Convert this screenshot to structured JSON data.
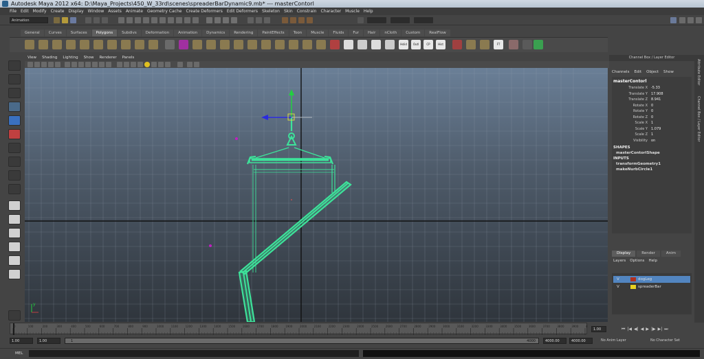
{
  "window": {
    "title": "Autodesk Maya 2012 x64: D:\\Maya_Projects\\450_W_33rd\\scenes\\spreaderBarDynamic9.mb*   ---   masterContorl"
  },
  "menubar": [
    "File",
    "Edit",
    "Modify",
    "Create",
    "Display",
    "Window",
    "Assets",
    "Animate",
    "Geometry Cache",
    "Create Deformers",
    "Edit Deformers",
    "Skeleton",
    "Skin",
    "Constrain",
    "Character",
    "Muscle",
    "Help"
  ],
  "status_line": {
    "mode": "Animation"
  },
  "shelf": {
    "tabs": [
      "General",
      "Curves",
      "Surfaces",
      "Polygons",
      "Subdivs",
      "Deformation",
      "Animation",
      "Dynamics",
      "Rendering",
      "PaintEffects",
      "Toon",
      "Muscle",
      "Fluids",
      "Fur",
      "Hair",
      "nCloth",
      "Custom",
      "RealFlow"
    ],
    "active_tab": "Polygons",
    "icon_labels": [
      "Hslid",
      "Outl",
      "CP",
      "Hist",
      "FT"
    ]
  },
  "panel": {
    "menu": [
      "View",
      "Shading",
      "Lighting",
      "Show",
      "Renderer",
      "Panels"
    ]
  },
  "channel_box": {
    "header": "Channel Box / Layer Editor",
    "menu": [
      "Channels",
      "Edit",
      "Object",
      "Show"
    ],
    "object": "masterContorl",
    "attributes": [
      {
        "label": "Translate X",
        "value": "-5.33"
      },
      {
        "label": "Translate Y",
        "value": "17.908"
      },
      {
        "label": "Translate Z",
        "value": "8.941"
      },
      {
        "label": "Rotate X",
        "value": "0"
      },
      {
        "label": "Rotate Y",
        "value": "0"
      },
      {
        "label": "Rotate Z",
        "value": "0"
      },
      {
        "label": "Scale X",
        "value": "1"
      },
      {
        "label": "Scale Y",
        "value": "1.079"
      },
      {
        "label": "Scale Z",
        "value": "1"
      },
      {
        "label": "Visibility",
        "value": "on"
      }
    ],
    "shapes_header": "SHAPES",
    "shape": "masterContorlShape",
    "inputs_header": "INPUTS",
    "inputs": [
      "transformGeometry1",
      "makeNurbCircle1"
    ]
  },
  "layer_editor": {
    "tabs": [
      "Display",
      "Render",
      "Anim"
    ],
    "active_tab": "Display",
    "menu": [
      "Layers",
      "Options",
      "Help"
    ],
    "layers": [
      {
        "vis": "V",
        "name": "dogLeg",
        "color": "#b03020",
        "selected": true
      },
      {
        "vis": "V",
        "name": "spreaderBar",
        "color": "#e8d020",
        "selected": false
      }
    ]
  },
  "side_tabs": [
    "Attribute Editor",
    "Channel Box / Layer Editor"
  ],
  "time_slider": {
    "ticks": [
      "0",
      "100",
      "200",
      "300",
      "400",
      "500",
      "600",
      "700",
      "800",
      "900",
      "1000",
      "1100",
      "1200",
      "1300",
      "1400",
      "1500",
      "1600",
      "1700",
      "1800",
      "1900",
      "2000",
      "2100",
      "2200",
      "2300",
      "2400",
      "2500",
      "2600",
      "2700",
      "2800",
      "2900",
      "3000",
      "3100",
      "3200",
      "3300",
      "3400",
      "3500",
      "3600",
      "3700",
      "3800",
      "3900",
      "4000"
    ],
    "current_frame": "1.00"
  },
  "range_slider": {
    "start_time": "1.00",
    "playback_start": "1.00",
    "range_handle": "1",
    "range_end": "4000",
    "playback_end": "4000.00",
    "end_time": "4000.00",
    "anim_layer": "No Anim Layer",
    "character_set": "No Character Set"
  },
  "command_line": {
    "label": "MEL"
  },
  "colors": {
    "wire": "#3de39a",
    "manip_y": "#22d040",
    "manip_z": "#2a2ae0",
    "pivot": "#c020c0"
  }
}
